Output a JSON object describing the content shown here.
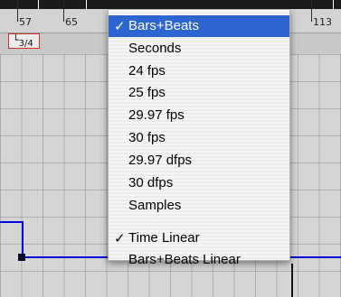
{
  "ruler": {
    "labels": [
      "57",
      "65",
      "113"
    ]
  },
  "time_signature": "3/4",
  "menu": {
    "items": [
      {
        "label": "Bars+Beats",
        "checked": true,
        "highlighted": true
      },
      {
        "label": "Seconds",
        "checked": false
      },
      {
        "label": "24 fps",
        "checked": false
      },
      {
        "label": "25 fps",
        "checked": false
      },
      {
        "label": "29.97 fps",
        "checked": false
      },
      {
        "label": "30 fps",
        "checked": false
      },
      {
        "label": "29.97 dfps",
        "checked": false
      },
      {
        "label": "30 dfps",
        "checked": false
      },
      {
        "label": "Samples",
        "checked": false
      }
    ],
    "mode_items": [
      {
        "label": "Time Linear",
        "checked": true
      },
      {
        "label": "Bars+Beats Linear",
        "checked": false
      }
    ],
    "check_glyph": "✓"
  },
  "colors": {
    "highlight": "#2d66d0",
    "tempo_line": "#0000d8",
    "signature_border": "#d2302b"
  }
}
